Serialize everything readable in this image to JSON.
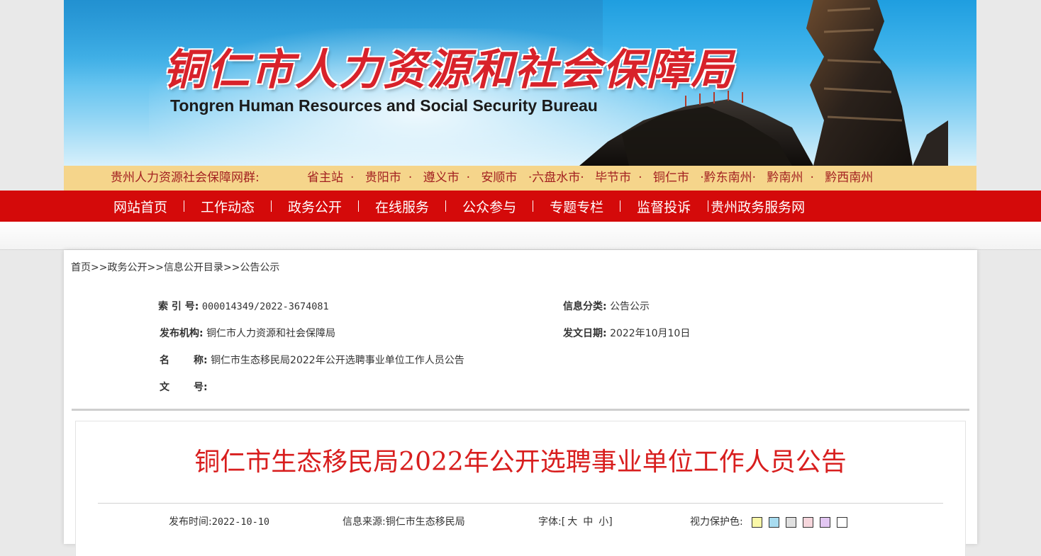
{
  "banner": {
    "title_cn": "铜仁市人力资源和社会保障局",
    "title_en": "Tongren Human Resources and Social Security Bureau"
  },
  "site_group": {
    "label": "贵州人力资源社会保障网群:",
    "links": [
      "省主站",
      "贵阳市",
      "遵义市",
      "安顺市",
      "·六盘水市·",
      "毕节市",
      "铜仁市",
      "·黔东南州·",
      "黔南州",
      "黔西南州"
    ]
  },
  "nav": {
    "items": [
      "网站首页",
      "工作动态",
      "政务公开",
      "在线服务",
      "公众参与",
      "专题专栏",
      "监督投诉",
      "贵州政务服务网"
    ]
  },
  "breadcrumb": {
    "items": [
      "首页",
      "政务公开",
      "信息公开目录",
      "公告公示"
    ],
    "separator": ">>"
  },
  "meta": {
    "index_label": "索 引 号:",
    "index_value": "000014349/2022-3674081",
    "category_label": "信息分类:",
    "category_value": "公告公示",
    "publisher_label": "发布机构:",
    "publisher_value": "铜仁市人力资源和社会保障局",
    "date_label": "发文日期:",
    "date_value": "2022年10月10日",
    "name_label_a": "名",
    "name_label_b": "称:",
    "name_value": "铜仁市生态移民局2022年公开选聘事业单位工作人员公告",
    "docno_label_a": "文",
    "docno_label_b": "号:",
    "docno_value": ""
  },
  "article": {
    "title": "铜仁市生态移民局2022年公开选聘事业单位工作人员公告",
    "publish_time_label": "发布时间:",
    "publish_time_value": "2022-10-10",
    "source_label": "信息来源:",
    "source_value": "铜仁市生态移民局",
    "font_label": "字体:",
    "font_open": "[",
    "font_large": "大",
    "font_medium": "中",
    "font_small": "小",
    "font_close": "]",
    "eye_label": "视力保护色:",
    "eye_colors": [
      "#faf8a8",
      "#a8dcf0",
      "#e0e0e0",
      "#f6d6dc",
      "#e2c6f2",
      "#ffffff"
    ]
  },
  "colors": {
    "nav_bg": "#d40a0a",
    "title_red": "#d81e1e",
    "strip_bg": "#f5d58b"
  }
}
